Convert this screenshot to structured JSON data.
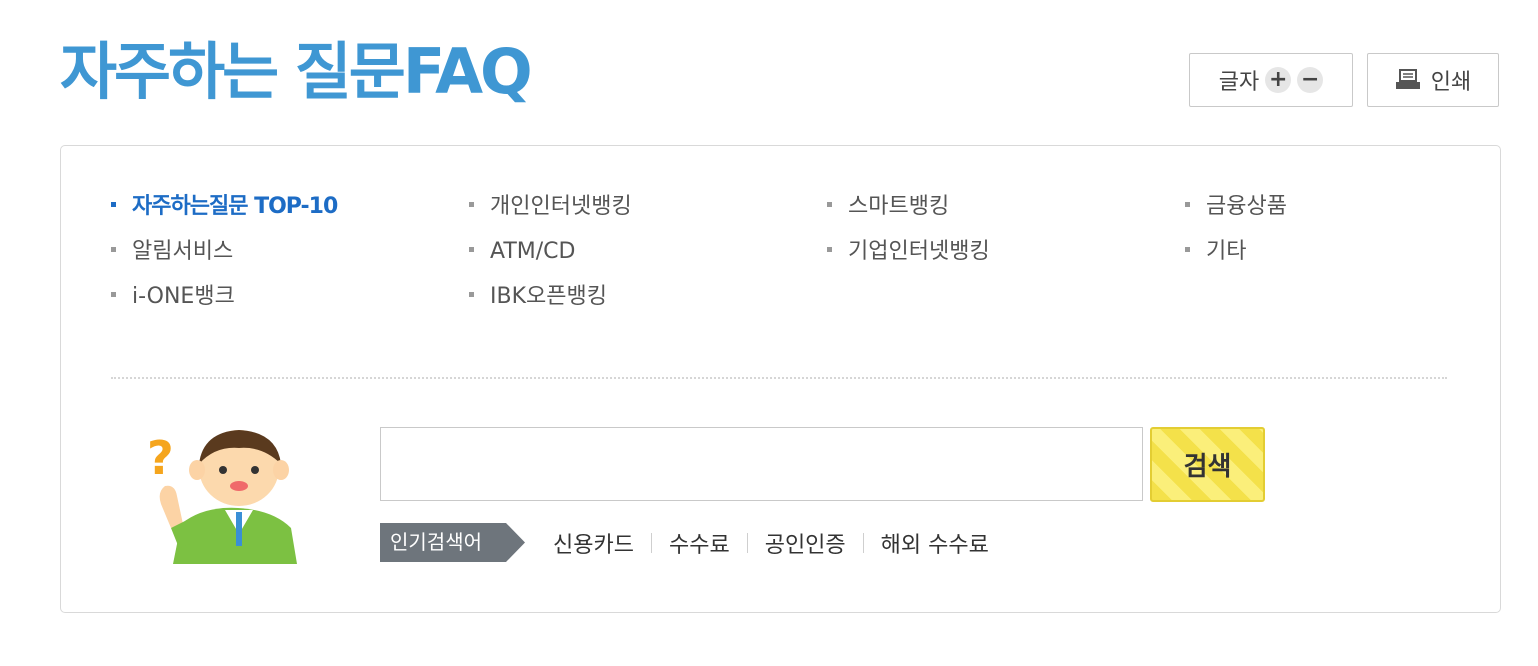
{
  "header": {
    "title": "자주하는 질문FAQ",
    "font_size_label": "글자",
    "increase_symbol": "+",
    "decrease_symbol": "−",
    "print_label": "인쇄",
    "title_color": "#3f97d3"
  },
  "categories": {
    "active_color": "#1d6cc5",
    "items": [
      {
        "label": "자주하는질문 TOP-10",
        "active": true
      },
      {
        "label": "개인인터넷뱅킹",
        "active": false
      },
      {
        "label": "스마트뱅킹",
        "active": false
      },
      {
        "label": "금융상품",
        "active": false
      },
      {
        "label": "알림서비스",
        "active": false
      },
      {
        "label": "ATM/CD",
        "active": false
      },
      {
        "label": "기업인터넷뱅킹",
        "active": false
      },
      {
        "label": "기타",
        "active": false
      },
      {
        "label": "i-ONE뱅크",
        "active": false
      },
      {
        "label": "IBK오픈뱅킹",
        "active": false
      }
    ]
  },
  "search": {
    "value": "",
    "button_label": "검색",
    "character_icon": "question-person-icon",
    "character_mark": "?"
  },
  "popular": {
    "label": "인기검색어",
    "keywords": [
      "신용카드",
      "수수료",
      "공인인증",
      "해외 수수료"
    ]
  }
}
